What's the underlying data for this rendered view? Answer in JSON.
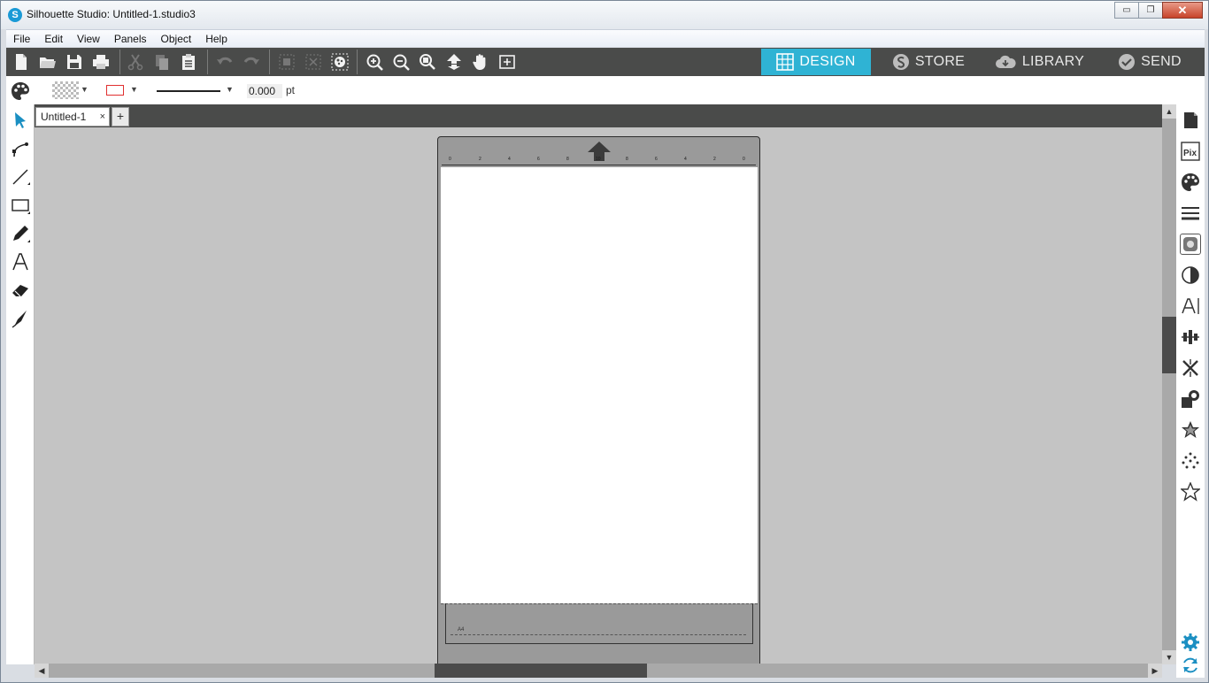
{
  "window": {
    "title": "Silhouette Studio: Untitled-1.studio3",
    "app_icon": "S",
    "controls": {
      "minimize": "▭",
      "maximize": "❐",
      "close": "✕"
    }
  },
  "menu": {
    "items": [
      "File",
      "Edit",
      "View",
      "Panels",
      "Object",
      "Help"
    ]
  },
  "toolbar": {
    "icons": [
      "new-document-icon",
      "open-folder-icon",
      "save-icon",
      "print-icon",
      "cut-icon",
      "copy-icon",
      "paste-icon",
      "undo-icon",
      "redo-icon",
      "group-icon",
      "ungroup-icon",
      "select-all-icon",
      "zoom-in-icon",
      "zoom-out-icon",
      "zoom-fit-icon",
      "move-down-icon",
      "pan-hand-icon",
      "fit-page-icon"
    ],
    "nav_tabs": [
      {
        "label": "DESIGN",
        "icon": "grid-icon",
        "active": true
      },
      {
        "label": "STORE",
        "icon": "silhouette-s-icon",
        "active": false
      },
      {
        "label": "LIBRARY",
        "icon": "cloud-icon",
        "active": false
      },
      {
        "label": "SEND",
        "icon": "checkmark-icon",
        "active": false
      }
    ],
    "colors": {
      "bar": "#4a4b4a",
      "active_tab": "#2fb3d4"
    }
  },
  "properties": {
    "line_width_value": "0.000",
    "line_width_unit": "pt",
    "line_color": "#e03030"
  },
  "tabs": {
    "document": "Untitled-1",
    "close_glyph": "×",
    "add_glyph": "+"
  },
  "left_tools": [
    "select-arrow-icon",
    "point-edit-icon",
    "line-tool-icon",
    "rectangle-tool-icon",
    "pencil-tool-icon",
    "text-tool-icon",
    "eraser-tool-icon",
    "knife-tool-icon"
  ],
  "right_tools": [
    "page-setup-icon",
    "pixscan-icon",
    "fill-color-icon",
    "line-style-icon",
    "registration-marks-icon",
    "contrast-icon",
    "text-style-icon",
    "align-icon",
    "replicate-icon",
    "transform-icon",
    "star-filled-icon",
    "trace-icon",
    "star-outline-icon",
    "settings-gear-icon",
    "sync-icon"
  ],
  "mat": {
    "bottom_label": "A4",
    "top_ruler_numbers": [
      "0",
      "2",
      "4",
      "6",
      "8",
      "10",
      "8",
      "6",
      "4",
      "2",
      "0"
    ]
  }
}
